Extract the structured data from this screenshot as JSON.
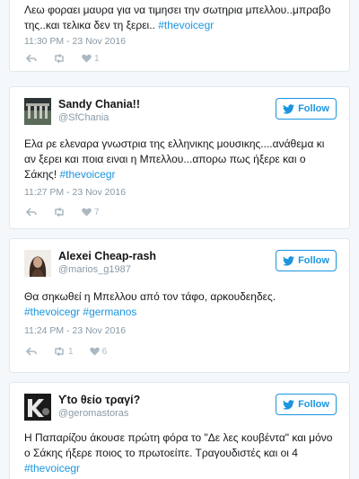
{
  "tweets": [
    {
      "text_line1": "Λεω φοραει μαυρα για να τιμησει την σωτηρια μπελλου..μπραβο",
      "text_line2_plain": "της..και τελικα δεν τη ξερει.. ",
      "text_line2_hashtag": "#thevoicegr",
      "date": "11:30 PM - 23 Nov 2016",
      "like_count": "1"
    },
    {
      "display_name": "Sandy Chania!!",
      "handle": "@SfChania",
      "follow_label": "Follow",
      "text_line1": "Ελα ρε ελεναρα γνωστρια της ελληνικης μουσικης....ανάθεμα κι",
      "text_line2": "αν ξερει και ποια ειναι η Μπελλου...απορω πως ήξερε και ο",
      "text_line3_plain": "Σάκης! ",
      "text_line3_hashtag": "#thevoicegr",
      "date": "11:27 PM - 23 Nov 2016",
      "like_count": "7"
    },
    {
      "display_name": "Alexei Cheap-rash",
      "handle": "@marios_g1987",
      "follow_label": "Follow",
      "text_line1": "Θα σηκωθεί η Μπελλου από τον τάφο, αρκουδεηδες.",
      "hashtag1": "#thevoicegr",
      "hashtag2": "#germanos",
      "date": "11:24 PM - 23 Nov 2016",
      "retweet_count": "1",
      "like_count": "6"
    },
    {
      "display_name": "ϒto θείο τραγί?",
      "handle": "@geromastoras",
      "follow_label": "Follow",
      "text_line1": "Η Παπαρίζου άκουσε πρώτη φόρα το \"Δε λες κουβέντα\" και μόνο",
      "text_line2": "ο Σάκης ήξερε ποιος το πρωτοείπε. Τραγουδιστές και οι 4",
      "hashtag": "#thevoicegr"
    }
  ],
  "colors": {
    "accent": "#1b95e0",
    "muted": "#8899a6",
    "icon": "#aab8c2"
  },
  "icons": [
    "reply-icon",
    "retweet-icon",
    "like-icon",
    "twitter-bird-icon"
  ]
}
